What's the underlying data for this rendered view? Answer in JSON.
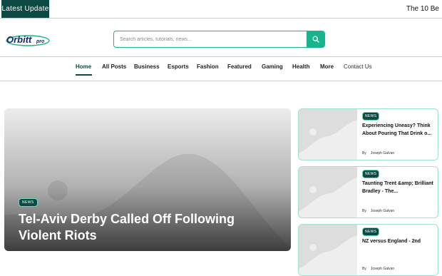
{
  "ticker": {
    "label": "Latest Update",
    "text": "The 10 Be"
  },
  "header": {
    "logo_text": "Orbitt pro",
    "search": {
      "placeholder": "Search articles, tutorials, news..."
    }
  },
  "nav": {
    "items": [
      {
        "label": "Home"
      },
      {
        "label": "All Posts"
      },
      {
        "label": "Business"
      },
      {
        "label": "Esports"
      },
      {
        "label": "Fashion"
      },
      {
        "label": "Featured"
      },
      {
        "label": "Gaming"
      },
      {
        "label": "Health"
      },
      {
        "label": "More"
      },
      {
        "label": "Contact Us"
      }
    ]
  },
  "hero": {
    "badge": "NEWS",
    "title": "Tel-Aviv Derby Called Off Following Violent Riots"
  },
  "side_posts": [
    {
      "badge": "NEWS",
      "title": "Experiencing Uneasy? Think About Pouring That Drink o...",
      "by": "By",
      "author": "Joseph Galvan"
    },
    {
      "badge": "NEWS",
      "title": "Taunting Trent &amp; Brilliant Bradley - The...",
      "by": "By",
      "author": "Joseph Galvan"
    },
    {
      "badge": "NEWS",
      "title": "NZ versus England - 2nd",
      "by": "By",
      "author": "Joseph Galvan"
    }
  ],
  "colors": {
    "accent": "#18b48e",
    "dark": "#0e4a44",
    "border": "#9fe3cf"
  }
}
